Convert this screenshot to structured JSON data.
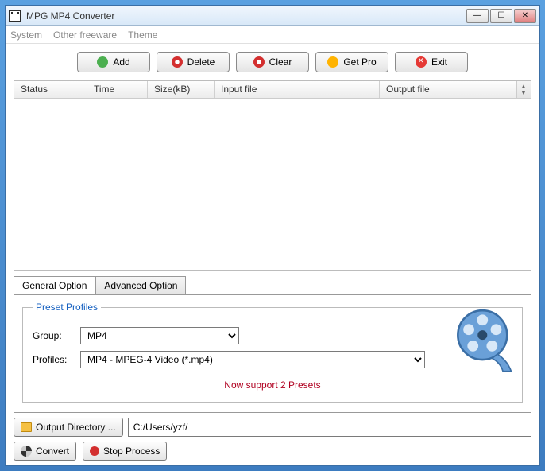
{
  "window": {
    "title": "MPG MP4 Converter"
  },
  "menu": {
    "system": "System",
    "freeware": "Other freeware",
    "theme": "Theme"
  },
  "toolbar": {
    "add": "Add",
    "delete": "Delete",
    "clear": "Clear",
    "getpro": "Get Pro",
    "exit": "Exit"
  },
  "columns": {
    "status": "Status",
    "time": "Time",
    "size": "Size(kB)",
    "input": "Input file",
    "output": "Output file"
  },
  "tabs": {
    "general": "General Option",
    "advanced": "Advanced Option"
  },
  "presets": {
    "legend": "Preset Profiles",
    "group_label": "Group:",
    "group_value": "MP4",
    "profiles_label": "Profiles:",
    "profiles_value": "MP4 - MPEG-4 Video (*.mp4)",
    "message": "Now support 2 Presets"
  },
  "output": {
    "button": "Output Directory ...",
    "path": "C:/Users/yzf/"
  },
  "actions": {
    "convert": "Convert",
    "stop": "Stop Process"
  }
}
